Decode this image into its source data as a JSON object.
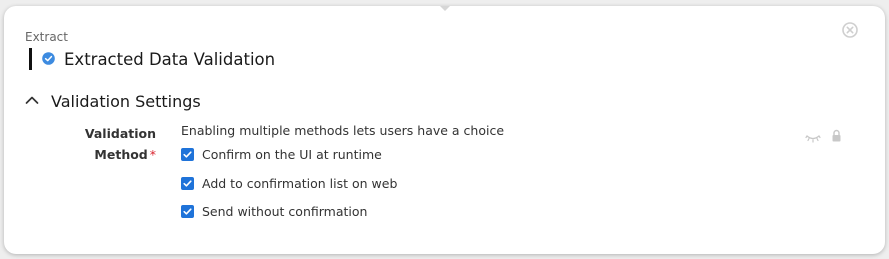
{
  "card": {
    "category": "Extract",
    "title": "Extracted Data Validation",
    "title_icon": "check-circle-icon",
    "close_icon": "close-circle-icon"
  },
  "section": {
    "title": "Validation Settings",
    "toggle_icon": "chevron-up-icon",
    "expanded": true
  },
  "field": {
    "label_line1": "Validation",
    "label_line2": "Method",
    "required_mark": "*",
    "hint": "Enabling multiple methods lets users have a choice",
    "options": [
      {
        "label": "Confirm on the UI at runtime",
        "checked": true
      },
      {
        "label": "Add to confirmation list on web",
        "checked": true
      },
      {
        "label": "Send without confirmation",
        "checked": true
      }
    ],
    "visibility_icon": "eye-closed-icon",
    "lock_icon": "lock-icon"
  },
  "colors": {
    "accent": "#1f73d9",
    "required": "#d9232e",
    "title_icon_blue": "#3d8be0",
    "muted_icon": "#c8c8c8"
  }
}
